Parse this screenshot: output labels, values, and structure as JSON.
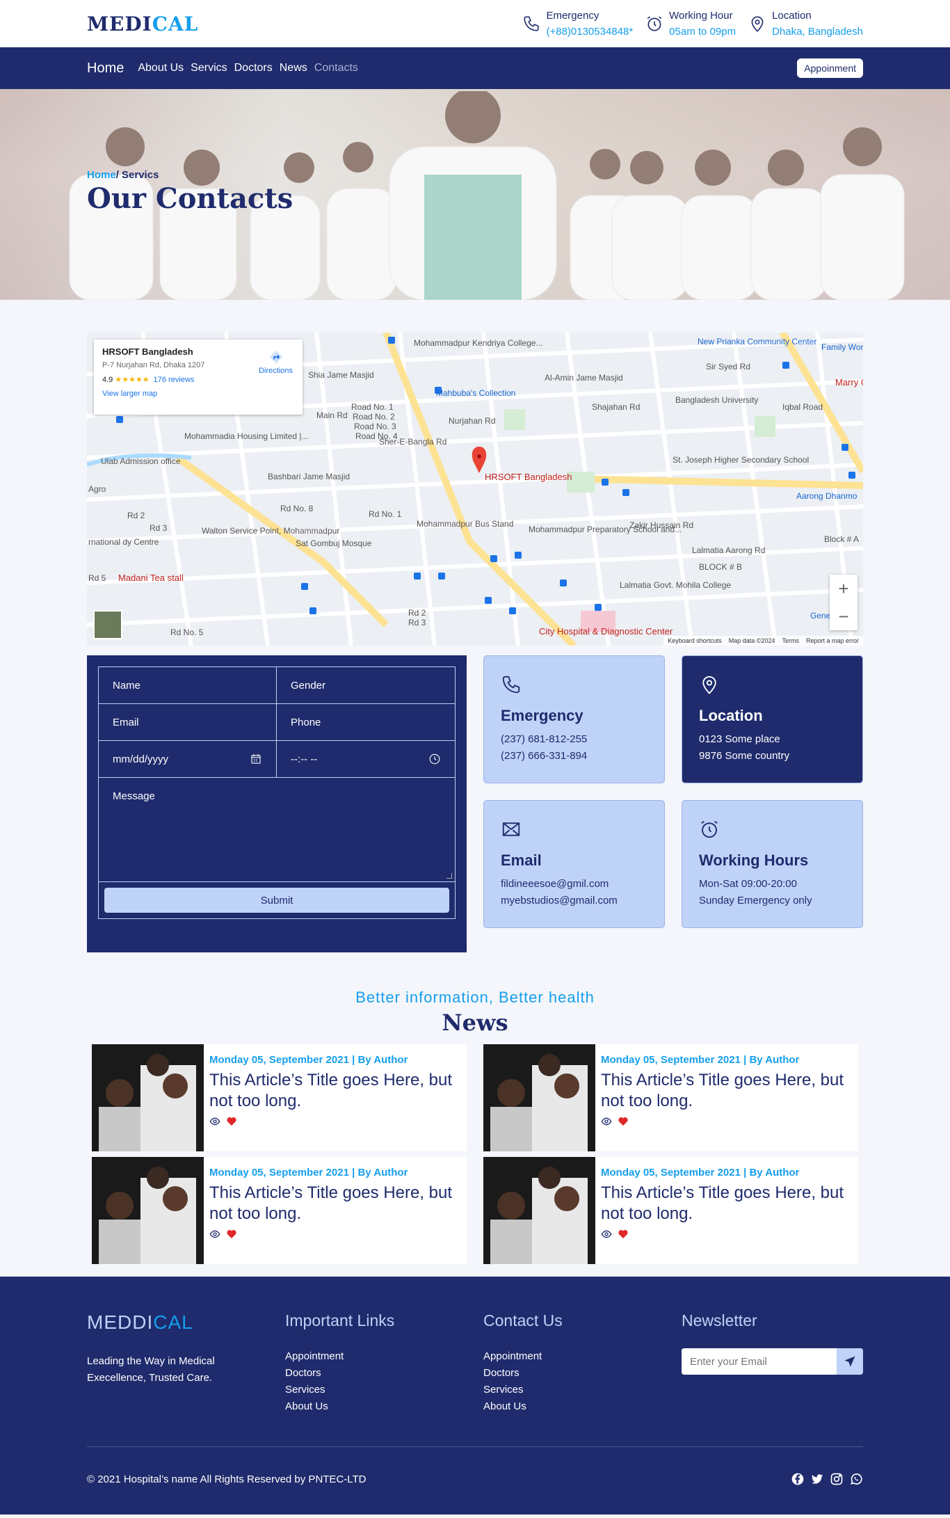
{
  "header": {
    "logo_main": "MEDI",
    "logo_accent": "CAL",
    "infos": [
      {
        "icon": "phone-icon",
        "title": "Emergency",
        "value": "(+88)0130534848*"
      },
      {
        "icon": "alarm-clock-icon",
        "title": "Working Hour",
        "value": "05am to 09pm"
      },
      {
        "icon": "location-pin-icon",
        "title": "Location",
        "value": "Dhaka, Bangladesh"
      }
    ]
  },
  "nav": {
    "items": [
      "Home",
      "About Us",
      "Servics",
      "Doctors",
      "News",
      "Contacts"
    ],
    "cta": "Appoinment"
  },
  "hero": {
    "breadcrumb_home": "Home",
    "breadcrumb_sep": "/ ",
    "breadcrumb_current": "Servics",
    "title": "Our Contacts"
  },
  "map": {
    "place_name": "HRSOFT Bangladesh",
    "address": "P-7 Nurjahan Rd, Dhaka 1207",
    "rating": "4.9",
    "stars": "★★★★★",
    "reviews": "176 reviews",
    "larger_map": "View larger map",
    "directions": "Directions",
    "pin_label": "HRSOFT Bangladesh",
    "labels": [
      "Mohammadpur Kendriya College...",
      "Shia Jame Masjid",
      "Mahbuba's Collection",
      "Al-Amin Jame Masjid",
      "New Prianka Community Center",
      "Family World Gr",
      "Sir Syed Rd",
      "Marry Gues",
      "Bangladesh University",
      "Shajahan Rd",
      "Mohammadia Housing Limited |...",
      "Bashbari Jame Masjid",
      "Ulab Admission office",
      "St. Joseph Higher Secondary School",
      "Aarong Dhanmo",
      "Agro",
      "Walton Service Point, Mohammadpur",
      "Mohammadpur Bus Stand",
      "Mohammadpur Preparatory School and...",
      "Lalmatia Aarong Rd",
      "Sat Gombuj Mosque",
      "Madani Tea stall",
      "Lalmatia Govt. Mohila College",
      "City Hospital & Diagnostic Center",
      "Genetic Pl",
      "Block # A",
      "BLOCK # B",
      "Zakir Hussain Rd",
      "Nurjahan Rd",
      "Main Rd",
      "Iqbal Road",
      "Sher-E-Bangla Rd",
      "Road No. 1",
      "Road No. 2",
      "Road No. 3",
      "Road No. 4",
      "Rd No. 8",
      "Rd No. 1",
      "Rd 2",
      "Rd 3",
      "Rd 5",
      "Rd No. 5",
      "Rd 2",
      "Rd 3",
      "rnational dy Centre"
    ],
    "footer": [
      "Keyboard shortcuts",
      "Map data ©2024",
      "Terms",
      "Report a map error"
    ]
  },
  "form": {
    "fields": [
      "Name",
      "Gender",
      "Email",
      "Phone"
    ],
    "date_placeholder": "mm/dd/yyyy",
    "time_placeholder": "--:-- --",
    "message_placeholder": "Message",
    "submit": "Submit"
  },
  "cards": [
    {
      "icon": "phone-icon",
      "style": "light",
      "title": "Emergency",
      "lines": [
        "(237) 681-812-255",
        "(237) 666-331-894"
      ]
    },
    {
      "icon": "location-pin-icon",
      "style": "dark",
      "title": "Location",
      "lines": [
        "0123 Some place",
        "9876 Some country"
      ]
    },
    {
      "icon": "mail-icon",
      "style": "light",
      "title": "Email",
      "lines": [
        "fildineeesoe@gmil.com",
        "myebstudios@gmail.com"
      ]
    },
    {
      "icon": "alarm-clock-icon",
      "style": "light",
      "title": "Working Hours",
      "lines": [
        "Mon-Sat 09:00-20:00",
        "Sunday Emergency only"
      ]
    }
  ],
  "news": {
    "subtitle": "Better information, Better health",
    "title": "News",
    "items": [
      {
        "meta": "Monday 05, September 2021 | By Author",
        "title": "This Article’s Title goes Here, but not too long."
      },
      {
        "meta": "Monday 05, September 2021 | By Author",
        "title": "This Article’s Title goes Here, but not too long."
      },
      {
        "meta": "Monday 05, September 2021 | By Author",
        "title": "This Article’s Title goes Here, but not too long."
      },
      {
        "meta": "Monday 05, September 2021 | By Author",
        "title": "This Article’s Title goes Here, but not too long."
      }
    ]
  },
  "footer": {
    "logo_main": "MEDDI",
    "logo_accent": "CAL",
    "tagline": "Leading the Way in Medical Execellence, Trusted Care.",
    "links_title": "Important Links",
    "links": [
      "Appointment",
      "Doctors",
      "Services",
      "About Us"
    ],
    "contact_title": "Contact Us",
    "contact_links": [
      "Appointment",
      "Doctors",
      "Services",
      "About Us"
    ],
    "newsletter_title": "Newsletter",
    "newsletter_placeholder": "Enter your Email",
    "copyright": "© 2021 Hospital’s name All Rights Reserved by PNTEC-LTD",
    "socials": [
      "facebook-icon",
      "twitter-icon",
      "instagram-icon",
      "whatsapp-icon"
    ]
  },
  "colors": {
    "primary": "#1f2b6c",
    "accent": "#159eec",
    "light": "#bfd2f8",
    "heart": "#e02828"
  }
}
